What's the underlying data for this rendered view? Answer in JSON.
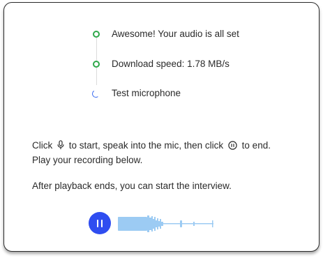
{
  "steps": [
    {
      "label": "Awesome! Your audio is all set",
      "status": "done",
      "icon": "check-circle-icon"
    },
    {
      "label": "Download speed: 1.78 MB/s",
      "status": "done",
      "icon": "check-circle-icon"
    },
    {
      "label": "Test microphone",
      "status": "in-progress",
      "icon": "spinner-icon"
    }
  ],
  "instructions": {
    "line1_a": "Click",
    "line1_b": "to start, speak into the mic, then click",
    "line1_c": "to end.",
    "line2": "Play your recording below.",
    "line3": "After playback ends, you can start the interview."
  },
  "player": {
    "state": "playing",
    "button_icon": "pause-icon",
    "waveform_icon": "audio-waveform-icon"
  },
  "colors": {
    "success": "#2ea84a",
    "accent": "#2f4df0",
    "waveform": "#9ccbf3",
    "spinner": "#3b6cf0"
  }
}
